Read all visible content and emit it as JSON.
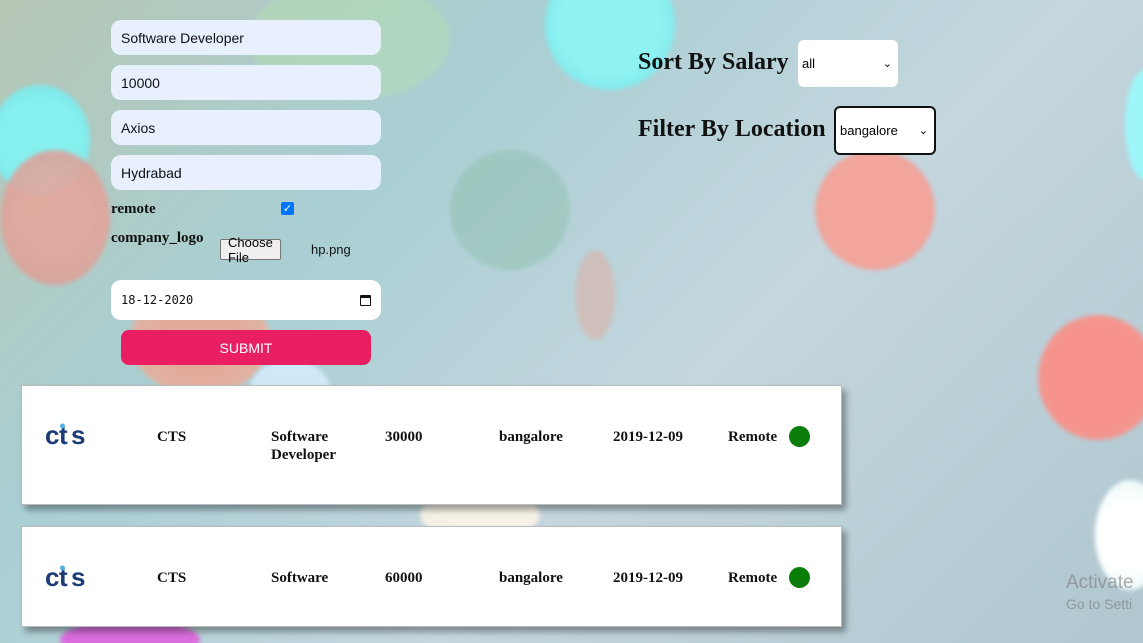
{
  "form": {
    "job_title": "Software Developer",
    "salary": "10000",
    "company": "Axios",
    "location": "Hydrabad",
    "remote_label": "remote",
    "remote_checked": true,
    "logo_label": "company_logo",
    "file_button": "Choose File",
    "file_name": "hp.png",
    "date": "18-12-2020",
    "submit_label": "SUBMIT"
  },
  "controls": {
    "sort_label": "Sort By Salary",
    "sort_value": "all",
    "filter_label": "Filter By Location",
    "filter_value": "bangalore"
  },
  "jobs": [
    {
      "company": "CTS",
      "title": "Software Developer",
      "salary": "30000",
      "location": "bangalore",
      "date": "2019-12-09",
      "type": "Remote",
      "status_color": "#0b7d0b"
    },
    {
      "company": "CTS",
      "title": "Software",
      "salary": "60000",
      "location": "bangalore",
      "date": "2019-12-09",
      "type": "Remote",
      "status_color": "#0b7d0b"
    }
  ],
  "watermark": {
    "line1": "Activate",
    "line2": "Go to Setti"
  },
  "colors": {
    "accent": "#e91e63",
    "input_bg": "#e8f0fe",
    "status_green": "#0b7d0b"
  },
  "icons": [
    "calendar-icon",
    "checkmark-icon",
    "chevron-down-icon",
    "company-logo",
    "status-dot"
  ]
}
